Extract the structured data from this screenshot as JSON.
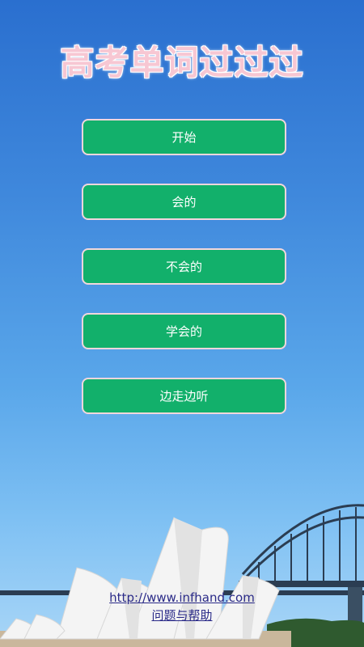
{
  "app": {
    "title": "高考单词过过过"
  },
  "menu": {
    "items": [
      {
        "label": "开始"
      },
      {
        "label": "会的"
      },
      {
        "label": "不会的"
      },
      {
        "label": "学会的"
      },
      {
        "label": "边走边听"
      }
    ]
  },
  "footer": {
    "url": "http://www.infhand.com",
    "help": "问题与帮助"
  },
  "colors": {
    "button": "#12b06b",
    "title": "#f7c7d3",
    "link": "#2a2a88"
  }
}
